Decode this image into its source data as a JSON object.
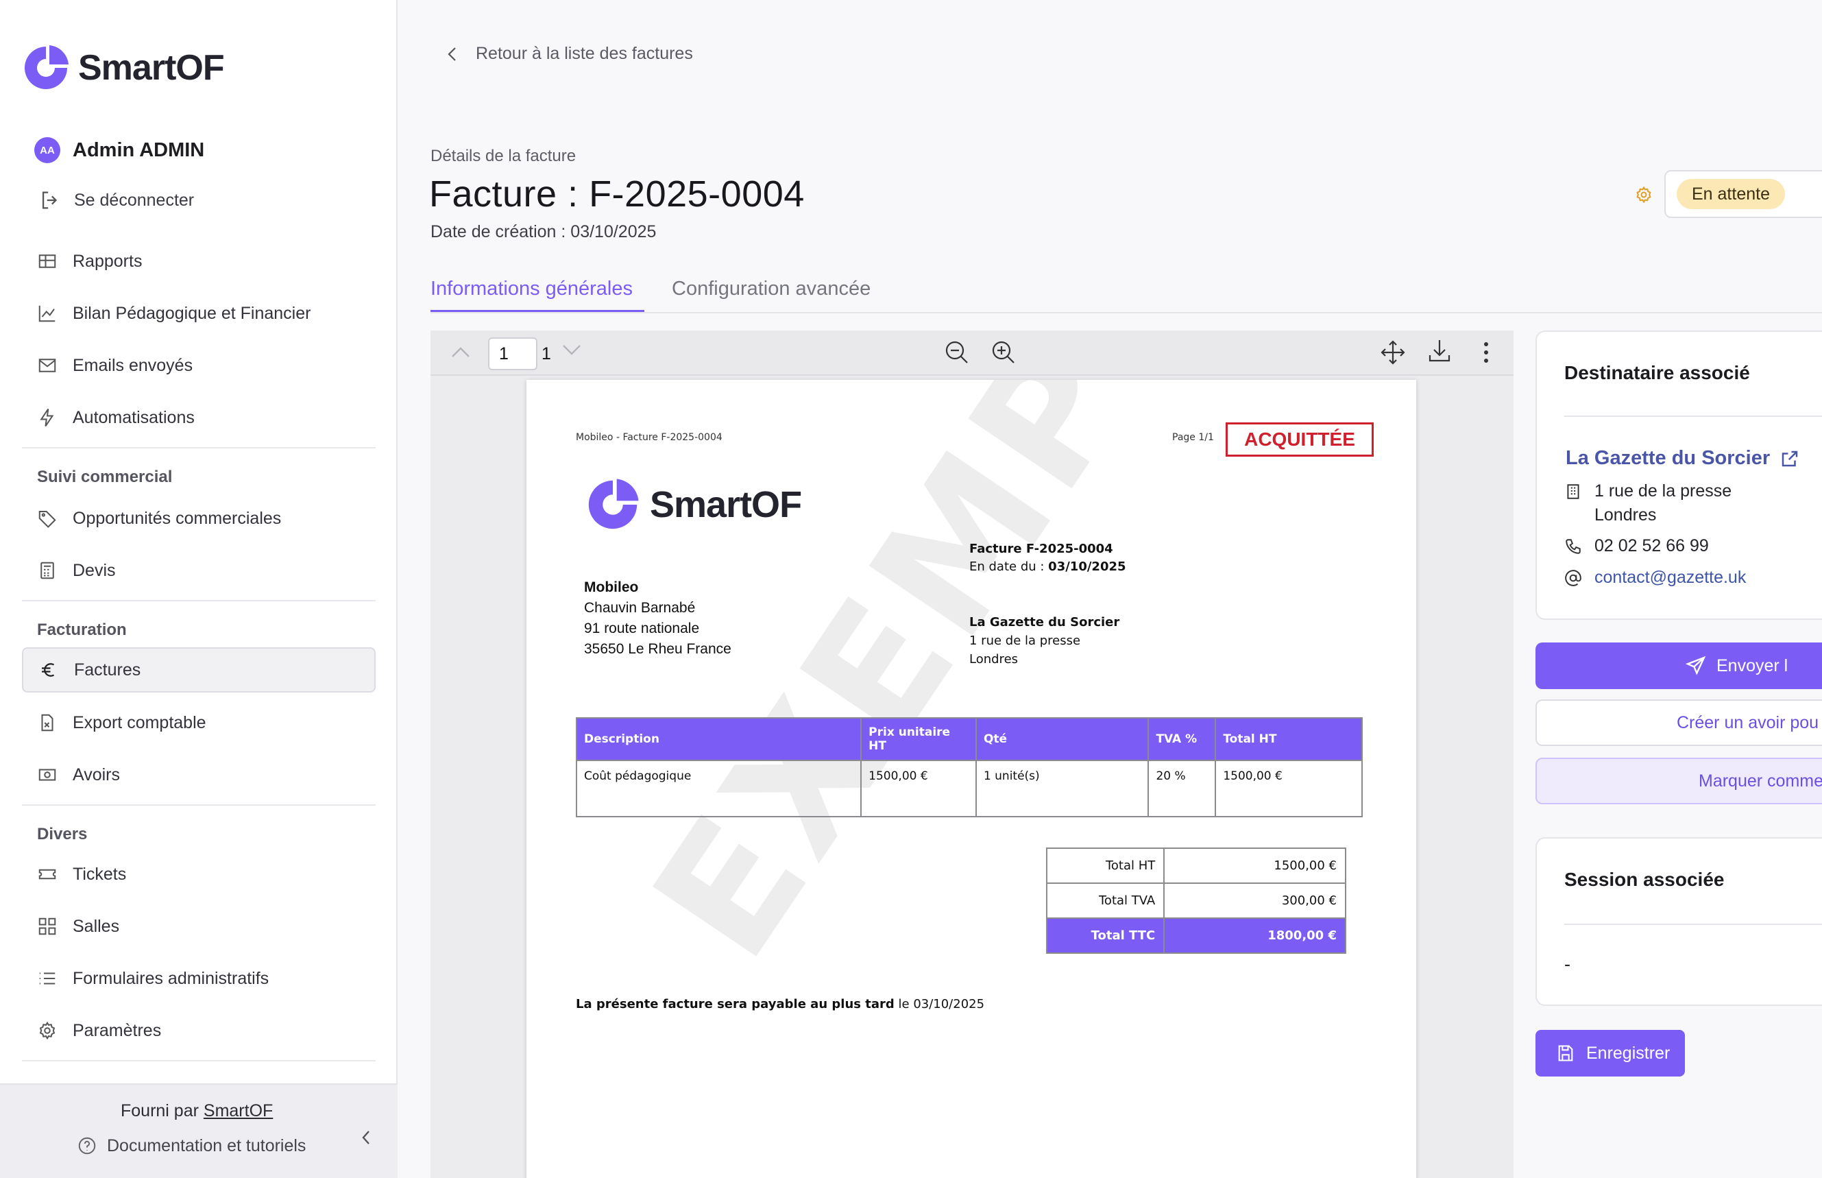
{
  "app": {
    "logo_text": "SmartOF",
    "brand_color": "#7b5cf5"
  },
  "user": {
    "initials": "AA",
    "name": "Admin ADMIN"
  },
  "logout_label": "Se déconnecter",
  "nav": {
    "items_top": [
      {
        "label": "Rapports",
        "icon": "table-icon"
      },
      {
        "label": "Bilan Pédagogique et Financier",
        "icon": "chart-line-icon"
      },
      {
        "label": "Emails envoyés",
        "icon": "envelope-icon"
      },
      {
        "label": "Automatisations",
        "icon": "lightning-icon"
      }
    ],
    "section_commercial": "Suivi commercial",
    "items_commercial": [
      {
        "label": "Opportunités commerciales",
        "icon": "tag-icon"
      },
      {
        "label": "Devis",
        "icon": "calculator-icon"
      }
    ],
    "section_facturation": "Facturation",
    "items_facturation": [
      {
        "label": "Factures",
        "icon": "euro-icon",
        "active": true
      },
      {
        "label": "Export comptable",
        "icon": "file-export-icon"
      },
      {
        "label": "Avoirs",
        "icon": "cash-icon"
      }
    ],
    "section_divers": "Divers",
    "items_divers": [
      {
        "label": "Tickets",
        "icon": "ticket-icon"
      },
      {
        "label": "Salles",
        "icon": "grid-icon"
      },
      {
        "label": "Formulaires administratifs",
        "icon": "list-icon"
      },
      {
        "label": "Paramètres",
        "icon": "gear-icon"
      }
    ]
  },
  "footer": {
    "powered_prefix": "Fourni par",
    "powered_link": "SmartOF",
    "docs": "Documentation et tutoriels"
  },
  "header": {
    "back": "Retour à la liste des factures",
    "subtitle": "Détails de la facture",
    "title": "Facture : F-2025-0004",
    "created": "Date de création : 03/10/2025",
    "status": "En attente",
    "status_color": "#fbe8b4"
  },
  "tabs": [
    "Informations générales",
    "Configuration avancée"
  ],
  "viewer": {
    "page_current": "1",
    "page_total": "1"
  },
  "invoice": {
    "header_left": "Mobileo - Facture F-2025-0004",
    "page": "Page 1/1",
    "stamp": "ACQUITTÉE",
    "logo_text": "SmartOF",
    "number": "Facture F-2025-0004",
    "date_prefix": "En date du :",
    "date": "03/10/2025",
    "from": {
      "company": "Mobileo",
      "contact": "Chauvin Barnabé",
      "street": "91 route nationale",
      "city": "35650 Le Rheu France"
    },
    "to": {
      "company": "La Gazette du Sorcier",
      "street": "1 rue de la presse",
      "city": "Londres"
    },
    "columns": [
      "Description",
      "Prix unitaire HT",
      "Qté",
      "TVA %",
      "Total HT"
    ],
    "rows": [
      [
        "Coût pédagogique",
        "1500,00 €",
        "1 unité(s)",
        "20 %",
        "1500,00 €"
      ]
    ],
    "totals": [
      {
        "label": "Total HT",
        "value": "1500,00 €"
      },
      {
        "label": "Total TVA",
        "value": "300,00 €"
      },
      {
        "label": "Total TTC",
        "value": "1800,00 €"
      }
    ],
    "due_bold": "La présente facture sera payable au plus tard",
    "due_date": "le 03/10/2025",
    "watermark": "EXEMPLE"
  },
  "recipient": {
    "title": "Destinataire associé",
    "name": "La Gazette du Sorcier",
    "street": "1 rue de la presse",
    "city": "Londres",
    "phone": "02 02 52 66 99",
    "email": "contact@gazette.uk"
  },
  "actions": {
    "send": "Envoyer l",
    "credit": "Créer un avoir pou",
    "mark": "Marquer comme"
  },
  "session": {
    "title": "Session associée",
    "value": "-"
  },
  "save": "Enregistrer"
}
